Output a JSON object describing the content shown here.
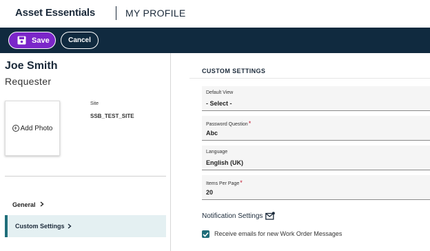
{
  "header": {
    "brand": "Asset Essentials",
    "page_title": "MY PROFILE"
  },
  "toolbar": {
    "save_label": "Save",
    "cancel_label": "Cancel"
  },
  "profile": {
    "name": "Joe Smith",
    "role": "Requester",
    "add_photo_label": "Add Photo",
    "site_label": "Site",
    "site_value": "SSB_TEST_SITE"
  },
  "nav": {
    "items": [
      {
        "label": "General",
        "selected": false
      },
      {
        "label": "Custom Settings",
        "selected": true
      }
    ]
  },
  "custom_settings": {
    "title": "CUSTOM SETTINGS",
    "fields": [
      {
        "label": "Default View",
        "value": "- Select -",
        "required": false
      },
      {
        "label": "Password Question",
        "value": "Abc",
        "required": true
      },
      {
        "label": "Language",
        "value": "English (UK)",
        "required": false
      },
      {
        "label": "Items Per Page",
        "value": "20",
        "required": true
      }
    ],
    "notifications": {
      "title": "Notification Settings",
      "checkbox_label": "Receive emails for new Work Order Messages",
      "checked": true
    }
  },
  "icons": {
    "save": "floppy-disk-icon",
    "add_photo": "plus-circle-icon",
    "chevron": "chevron-right-icon",
    "notification": "mail-notification-icon",
    "checkbox": "check-icon"
  },
  "colors": {
    "header_bar": "#102a3f",
    "save_button": "#7b26c9",
    "accent_teal": "#1f6e7a",
    "selected_nav_bg": "#e4f0f2",
    "required_mark": "#c0182e"
  }
}
